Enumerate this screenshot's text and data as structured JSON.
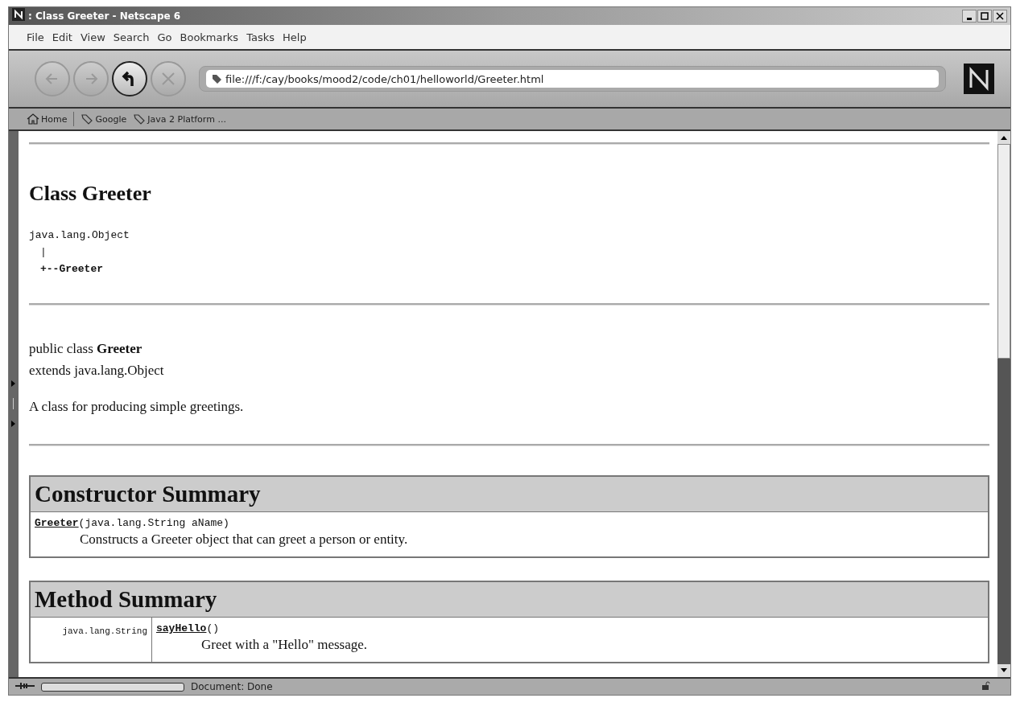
{
  "window": {
    "title": ": Class Greeter - Netscape 6"
  },
  "menu": [
    "File",
    "Edit",
    "View",
    "Search",
    "Go",
    "Bookmarks",
    "Tasks",
    "Help"
  ],
  "nav_buttons": [
    {
      "kind": "back",
      "disabled": true
    },
    {
      "kind": "forward",
      "disabled": true
    },
    {
      "kind": "reload",
      "disabled": false
    },
    {
      "kind": "stop",
      "disabled": true
    }
  ],
  "address": {
    "value": "file:///f:/cay/books/mood2/code/ch01/helloworld/Greeter.html"
  },
  "bookmarks": [
    {
      "kind": "home",
      "label": "Home"
    },
    {
      "kind": "link",
      "label": "Google"
    },
    {
      "kind": "link",
      "label": "Java 2 Platform ..."
    }
  ],
  "page": {
    "heading": "Class Greeter",
    "hierarchy": {
      "parent": "java.lang.Object",
      "bar": "|",
      "child": "+--Greeter"
    },
    "declaration": "public class **Greeter**",
    "extends": "extends java.lang.Object",
    "description": "A class for producing simple greetings.",
    "constructor_summary": {
      "title": "Constructor Summary",
      "rows": [
        {
          "name": "Greeter",
          "params": "(java.lang.String aName)",
          "description": "Constructs a Greeter object that can greet a person or entity."
        }
      ]
    },
    "method_summary": {
      "title": "Method Summary",
      "rows": [
        {
          "type": "java.lang.String",
          "name": "sayHello",
          "params": "()",
          "description": "Greet with a \"Hello\" message."
        }
      ]
    }
  },
  "status_bar": {
    "text": "Document: Done",
    "progress": {
      "level": 0
    }
  }
}
